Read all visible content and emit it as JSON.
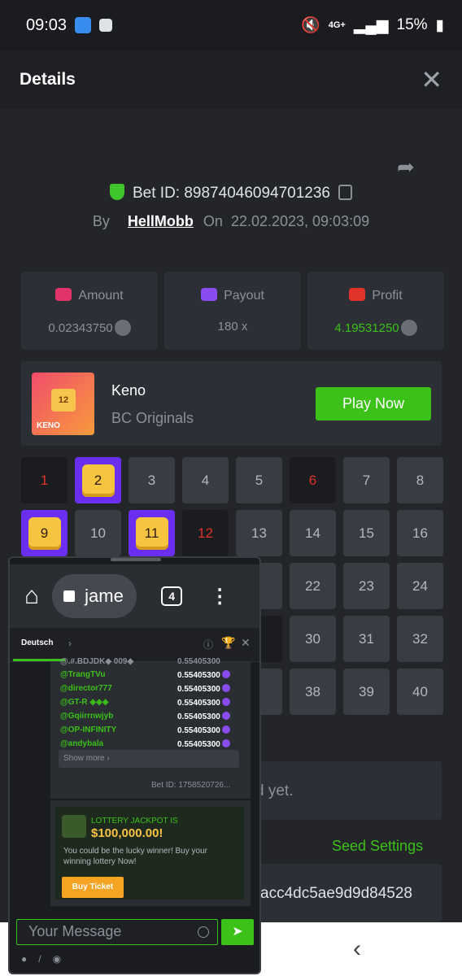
{
  "statusbar": {
    "time": "09:03",
    "battery": "15%",
    "network": "4G+"
  },
  "header": {
    "title": "Details",
    "close": "✕"
  },
  "bet": {
    "label": "Bet ID: 89874046094701236",
    "by": "By",
    "user": "HellMobb",
    "on": "On",
    "date": "22.02.2023, 09:03:09"
  },
  "stats": {
    "amount_label": "Amount",
    "amount_value": "0.02343750",
    "payout_label": "Payout",
    "payout_value": "180 x",
    "profit_label": "Profit",
    "profit_value": "4.19531250"
  },
  "game": {
    "name": "Keno",
    "provider": "BC Originals",
    "play": "Play Now",
    "thumb_number": "12",
    "thumb_label": "KENO"
  },
  "grid": {
    "c1": "1",
    "c2": "2",
    "c3": "3",
    "c4": "4",
    "c5": "5",
    "c6": "6",
    "c7": "7",
    "c8": "8",
    "c9": "9",
    "c10": "10",
    "c11": "11",
    "c12": "12",
    "c13": "13",
    "c14": "14",
    "c15": "15",
    "c16": "16",
    "c21": "1",
    "c22": "22",
    "c23": "23",
    "c24": "24",
    "c29": "9",
    "c30": "30",
    "c31": "31",
    "c32": "32",
    "c37": "7",
    "c38": "38",
    "c39": "39",
    "c40": "40"
  },
  "fairness": {
    "not_yet": "d yet.",
    "seed_settings": "Seed Settings",
    "hash": "acc4dc5ae9d9d84528"
  },
  "popup": {
    "url": "jame",
    "tabs": "4",
    "lang": "Deutsch",
    "rows": [
      {
        "name": "@TrangTVu",
        "value": "0.55405300"
      },
      {
        "name": "@director777",
        "value": "0.55405300"
      },
      {
        "name": "@GT-R ◈◈◈",
        "value": "0.55405300"
      },
      {
        "name": "@Gqiirrnwjyb",
        "value": "0.55405300"
      },
      {
        "name": "@OP-INFINITY",
        "value": "0.55405300"
      },
      {
        "name": "@andybala",
        "value": "0.55405300"
      }
    ],
    "partial_row": "@.#.BDJDK◆ 009◆",
    "partial_value": "0.55405300",
    "show_more": "Show more ›",
    "bet_id": "Bet ID: 1758520726...",
    "lottery_line1": "LOTTERY JACKPOT IS",
    "lottery_amount": "$100,000.00!",
    "lottery_text": "You could be the lucky winner! Buy your winning lottery Now!",
    "buy_ticket": "Buy Ticket",
    "message_placeholder": "Your Message"
  },
  "colors": {
    "accent": "#3bc117",
    "miss": "#e2332b",
    "hit": "#6a2ef0",
    "gold": "#f7c440"
  }
}
